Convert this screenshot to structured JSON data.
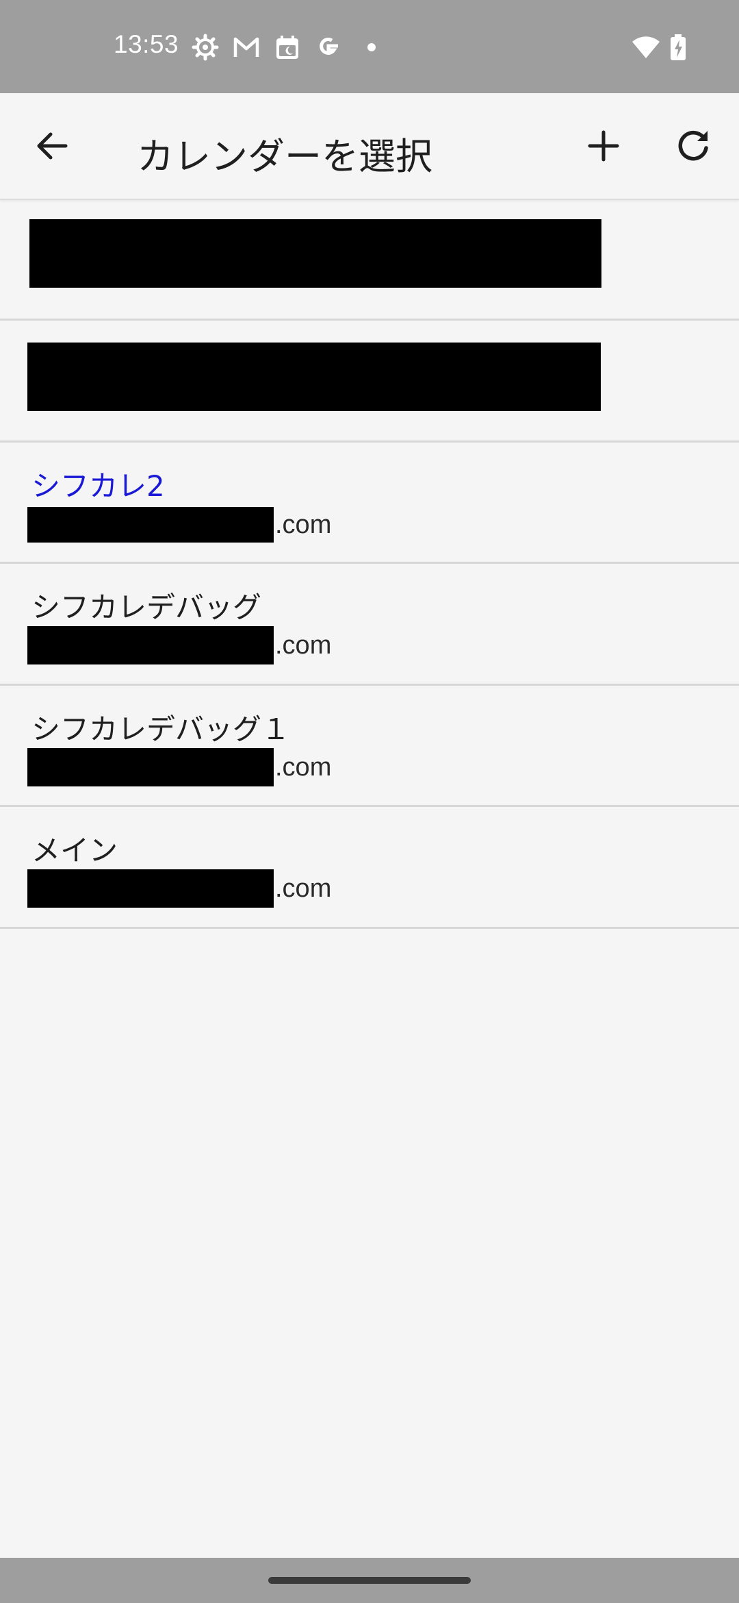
{
  "status_bar": {
    "time": "13:53",
    "icons": [
      "settings-gear-icon",
      "gmail-icon",
      "calendar-app-icon",
      "google-icon",
      "notification-dot-icon",
      "wifi-icon",
      "battery-charging-icon"
    ]
  },
  "app_bar": {
    "title": "カレンダーを選択",
    "back_icon": "arrow-back-icon",
    "add_icon": "plus-icon",
    "refresh_icon": "refresh-icon"
  },
  "calendars": [
    {
      "name": "",
      "account_suffix": "",
      "redacted": true
    },
    {
      "name": "",
      "account_suffix": "",
      "redacted": true
    },
    {
      "name": "シフカレ2",
      "account_suffix": ".com",
      "selected": true
    },
    {
      "name": "シフカレデバッグ",
      "account_suffix": ".com",
      "selected": false
    },
    {
      "name": "シフカレデバッグ１",
      "account_suffix": ".com",
      "selected": false
    },
    {
      "name": "メイン",
      "account_suffix": ".com",
      "selected": false
    }
  ],
  "colors": {
    "status_bar": "#9e9e9e",
    "background": "#f5f5f5",
    "selected_text": "#1a1ad6",
    "redaction": "#000000"
  }
}
